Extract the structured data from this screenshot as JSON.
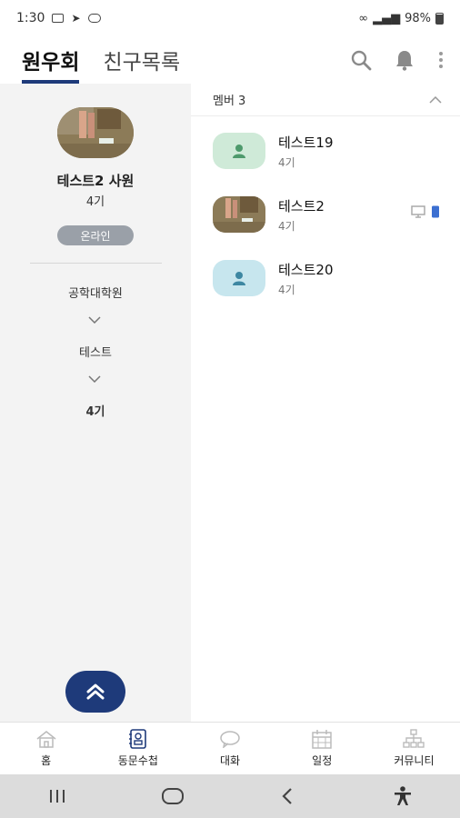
{
  "status_bar": {
    "time": "1:30",
    "battery": "98%"
  },
  "header": {
    "tabs": [
      {
        "label": "원우회",
        "active": true
      },
      {
        "label": "친구목록",
        "active": false
      }
    ],
    "icons": [
      "search-icon",
      "bell-icon",
      "more-vert-icon"
    ]
  },
  "profile": {
    "name": "테스트2 사원",
    "generation": "4기",
    "status": "온라인",
    "org_path": [
      "공학대학원",
      "테스트",
      "4기"
    ]
  },
  "members": {
    "header": "멤버 3",
    "list": [
      {
        "name": "테스트19",
        "generation": "4기",
        "avatar": "default-green",
        "avatar_color": "#cfead8"
      },
      {
        "name": "테스트2",
        "generation": "4기",
        "avatar": "photo",
        "devices": [
          "desktop-icon",
          "mobile-icon"
        ]
      },
      {
        "name": "테스트20",
        "generation": "4기",
        "avatar": "default-blue",
        "avatar_color": "#c7e6ee"
      }
    ]
  },
  "bottom_nav": [
    {
      "label": "홈",
      "icon": "home-icon",
      "active": false
    },
    {
      "label": "동문수첩",
      "icon": "address-book-icon",
      "active": true
    },
    {
      "label": "대화",
      "icon": "chat-icon",
      "active": false
    },
    {
      "label": "일정",
      "icon": "calendar-icon",
      "active": false
    },
    {
      "label": "커뮤니티",
      "icon": "community-icon",
      "active": false
    }
  ],
  "colors": {
    "accent": "#1e3a7a",
    "online_badge": "#9aa0a8",
    "pane_bg": "#f3f3f3"
  }
}
